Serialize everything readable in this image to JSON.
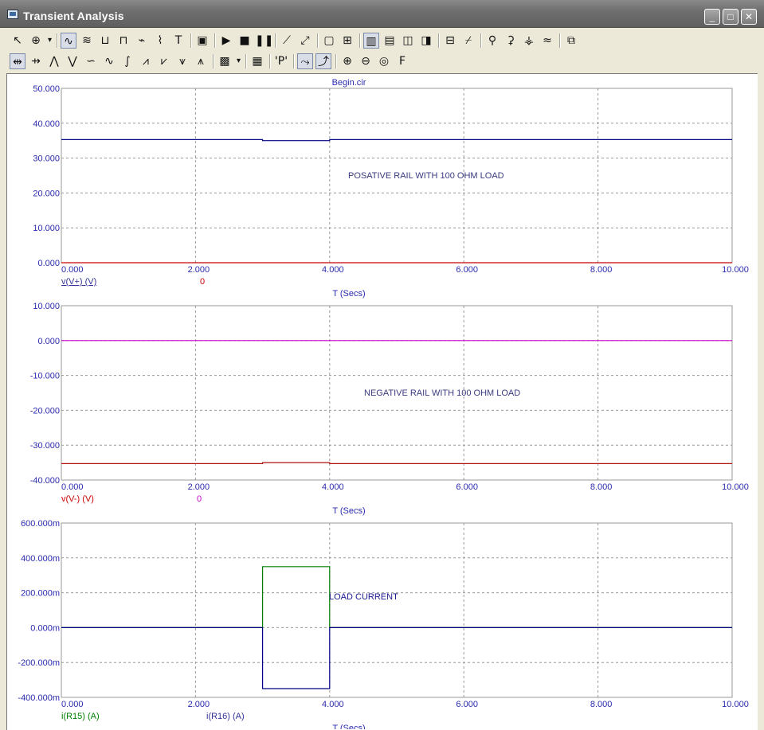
{
  "window": {
    "title": "Transient Analysis",
    "controls": [
      {
        "name": "minimize-button",
        "glyph": "_"
      },
      {
        "name": "maximize-button",
        "glyph": "□"
      },
      {
        "name": "close-button",
        "glyph": "✕"
      }
    ]
  },
  "toolbar1": [
    {
      "name": "select-mode-tool",
      "glyph": "↖"
    },
    {
      "name": "scale-mode-tool",
      "glyph": "⊕"
    },
    {
      "name": "dropdown-arrow-icon",
      "glyph": "▾"
    },
    {
      "sep": true
    },
    {
      "name": "cursor-mode-tool",
      "glyph": "∿",
      "pressed": true
    },
    {
      "name": "point-tag-tool",
      "glyph": "≋"
    },
    {
      "name": "horizontal-tag-tool",
      "glyph": "⊔"
    },
    {
      "name": "vertical-tag-tool",
      "glyph": "⊓"
    },
    {
      "name": "performance-tag-tool",
      "glyph": "⌁"
    },
    {
      "name": "info-tool",
      "glyph": "⌇"
    },
    {
      "name": "text-mode-tool",
      "glyph": "T"
    },
    {
      "sep": true
    },
    {
      "name": "properties-tool",
      "glyph": "▣"
    },
    {
      "sep": true
    },
    {
      "name": "run-icon",
      "glyph": "▶"
    },
    {
      "name": "stop-icon",
      "glyph": "■"
    },
    {
      "name": "pause-icon",
      "glyph": "❚❚"
    },
    {
      "sep": true
    },
    {
      "name": "linear-plot-tool",
      "glyph": "⟋"
    },
    {
      "name": "log-plot-tool",
      "glyph": "⤢"
    },
    {
      "sep": true
    },
    {
      "name": "axes-tool",
      "glyph": "▢"
    },
    {
      "name": "grid-tool",
      "glyph": "⊞"
    },
    {
      "sep": true
    },
    {
      "name": "minor-grid-tool",
      "glyph": "▥",
      "pressed": true
    },
    {
      "name": "ruler-tool",
      "glyph": "▤"
    },
    {
      "name": "plus-mode-tool",
      "glyph": "◫"
    },
    {
      "name": "horizontal-axis-grid-tool",
      "glyph": "◨"
    },
    {
      "sep": true
    },
    {
      "name": "baseline-tool",
      "glyph": "⊟"
    },
    {
      "name": "data-points-tool",
      "glyph": "⌿"
    },
    {
      "sep": true
    },
    {
      "name": "peak-tool",
      "glyph": "⚲"
    },
    {
      "name": "valley-tool",
      "glyph": "⚳"
    },
    {
      "name": "high-tool",
      "glyph": "⚶"
    },
    {
      "name": "low-tool",
      "glyph": "≈"
    },
    {
      "sep": true
    },
    {
      "name": "export-tool",
      "glyph": "⧉"
    }
  ],
  "toolbar2": [
    {
      "name": "cursor-left-tool",
      "glyph": "⇹",
      "pressed": true
    },
    {
      "name": "cursor-right-tool",
      "glyph": "⇸"
    },
    {
      "name": "next-peak-tool",
      "glyph": "⋀"
    },
    {
      "name": "next-valley-tool",
      "glyph": "⋁"
    },
    {
      "name": "next-high-tool",
      "glyph": "∽"
    },
    {
      "name": "next-low-tool",
      "glyph": "∿"
    },
    {
      "name": "next-inflection-tool",
      "glyph": "∫"
    },
    {
      "name": "global-high-tool",
      "glyph": "⩘"
    },
    {
      "name": "global-low-tool",
      "glyph": "⩗"
    },
    {
      "name": "top-tool",
      "glyph": "⩛"
    },
    {
      "name": "bottom-tool",
      "glyph": "⩚"
    },
    {
      "sep": true
    },
    {
      "name": "waveform-buffer-tool",
      "glyph": "▩"
    },
    {
      "name": "dropdown-arrow-icon",
      "glyph": "▾"
    },
    {
      "sep": true
    },
    {
      "name": "numeric-output-tool",
      "glyph": "▦"
    },
    {
      "sep": true
    },
    {
      "name": "page-tool",
      "glyph": "'P'"
    },
    {
      "sep": true
    },
    {
      "name": "tag-x-tool",
      "glyph": "⤳",
      "pressed": true
    },
    {
      "name": "tag-y-tool",
      "glyph": "⤴",
      "pressed": true
    },
    {
      "sep": true
    },
    {
      "name": "zoom-in-icon",
      "glyph": "⊕"
    },
    {
      "name": "zoom-out-icon",
      "glyph": "⊖"
    },
    {
      "name": "animate-tool",
      "glyph": "◎"
    },
    {
      "name": "font-tool",
      "glyph": "F"
    }
  ],
  "chart_data": [
    {
      "type": "line",
      "title": "Begin.cir",
      "annotation": "POSATIVE RAIL WITH 100 OHM LOAD",
      "xlabel": "T (Secs)",
      "xlim": [
        0,
        10
      ],
      "ylim": [
        0,
        50
      ],
      "xticks": [
        "0.000",
        "2.000",
        "4.000",
        "6.000",
        "8.000",
        "10.000"
      ],
      "yticks": [
        "50.000",
        "40.000",
        "30.000",
        "20.000",
        "10.000",
        "0.000"
      ],
      "grid": true,
      "legend": [
        {
          "label": "v(V+) (V)",
          "color": "#333399"
        },
        {
          "label": "0",
          "color": "#cc0000"
        }
      ],
      "series": [
        {
          "name": "v(V+) (V)",
          "color": "#000080",
          "x": [
            0,
            3,
            3,
            4,
            4,
            10
          ],
          "y": [
            35.3,
            35.3,
            35.0,
            35.0,
            35.3,
            35.3
          ]
        },
        {
          "name": "0",
          "color": "#cc0000",
          "x": [
            0,
            10
          ],
          "y": [
            0,
            0
          ]
        }
      ]
    },
    {
      "type": "line",
      "title": "",
      "annotation": "NEGATIVE RAIL WITH 100 OHM LOAD",
      "xlabel": "T (Secs)",
      "xlim": [
        0,
        10
      ],
      "ylim": [
        -40,
        10
      ],
      "xticks": [
        "0.000",
        "2.000",
        "4.000",
        "6.000",
        "8.000",
        "10.000"
      ],
      "yticks": [
        "10.000",
        "0.000",
        "-10.000",
        "-20.000",
        "-30.000",
        "-40.000"
      ],
      "grid": true,
      "legend": [
        {
          "label": "v(V-) (V)",
          "color": "#cc0000"
        },
        {
          "label": "0",
          "color": "#cc00cc"
        }
      ],
      "series": [
        {
          "name": "v(V-) (V)",
          "color": "#b01010",
          "x": [
            0,
            3,
            3,
            4,
            4,
            10
          ],
          "y": [
            -35.3,
            -35.3,
            -35.0,
            -35.0,
            -35.3,
            -35.3
          ]
        },
        {
          "name": "0",
          "color": "#cc00cc",
          "x": [
            0,
            10
          ],
          "y": [
            0,
            0
          ]
        }
      ]
    },
    {
      "type": "line",
      "title": "",
      "annotation": "LOAD CURRENT",
      "xlabel": "T (Secs)",
      "xlim": [
        0,
        10
      ],
      "ylim": [
        -400,
        600
      ],
      "xticks": [
        "0.000",
        "2.000",
        "4.000",
        "6.000",
        "8.000",
        "10.000"
      ],
      "yticks": [
        "600.000m",
        "400.000m",
        "200.000m",
        "0.000m",
        "-200.000m",
        "-400.000m"
      ],
      "grid": true,
      "legend": [
        {
          "label": "i(R15) (A)",
          "color": "#008000"
        },
        {
          "label": "i(R16) (A)",
          "color": "#333399"
        }
      ],
      "series": [
        {
          "name": "i(R15) (A)",
          "color": "#008000",
          "x": [
            0,
            3,
            3,
            4,
            4,
            10
          ],
          "y": [
            0,
            0,
            350,
            350,
            0,
            0
          ]
        },
        {
          "name": "i(R16) (A)",
          "color": "#000080",
          "x": [
            0,
            3,
            3,
            4,
            4,
            10
          ],
          "y": [
            0,
            0,
            -350,
            -350,
            0,
            0
          ]
        }
      ]
    }
  ]
}
